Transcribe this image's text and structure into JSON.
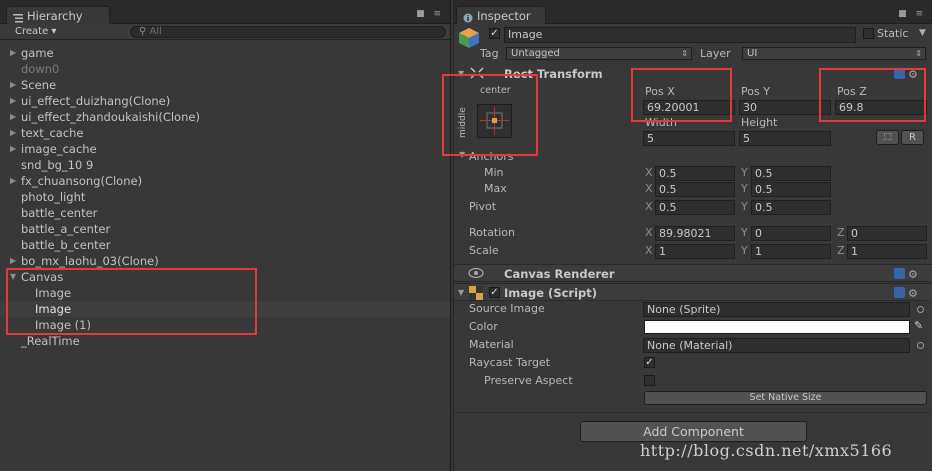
{
  "hierarchy": {
    "tab_title": "Hierarchy",
    "create_label": "Create ▾",
    "search_placeholder": "All",
    "items": [
      {
        "label": "game",
        "expandable": true
      },
      {
        "label": "down0",
        "expandable": false,
        "dim": true
      },
      {
        "label": "Scene",
        "expandable": true
      },
      {
        "label": "ui_effect_duizhang(Clone)",
        "expandable": true
      },
      {
        "label": "ui_effect_zhandoukaishi(Clone)",
        "expandable": true
      },
      {
        "label": "text_cache",
        "expandable": true
      },
      {
        "label": "image_cache",
        "expandable": true
      },
      {
        "label": "snd_bg_10 9",
        "expandable": false
      },
      {
        "label": "fx_chuansong(Clone)",
        "expandable": true
      },
      {
        "label": "photo_light",
        "expandable": false
      },
      {
        "label": "battle_center",
        "expandable": false
      },
      {
        "label": "battle_a_center",
        "expandable": false
      },
      {
        "label": "battle_b_center",
        "expandable": false
      },
      {
        "label": "bo_mx_laohu_03(Clone)",
        "expandable": true
      },
      {
        "label": "Canvas",
        "expandable": true,
        "expanded": true
      },
      {
        "label": "Image",
        "expandable": false,
        "child": true
      },
      {
        "label": "Image",
        "expandable": false,
        "child": true,
        "selected": true
      },
      {
        "label": "Image (1)",
        "expandable": false,
        "child": true
      },
      {
        "label": "_RealTime",
        "expandable": false
      }
    ]
  },
  "inspector": {
    "tab_title": "Inspector",
    "object_name": "Image",
    "static_label": "Static",
    "tag_label": "Tag",
    "tag_value": "Untagged",
    "layer_label": "Layer",
    "layer_value": "UI",
    "rect_transform": {
      "title": "Rect Transform",
      "anchor_preset_h": "center",
      "anchor_preset_v": "middle",
      "pos_x_label": "Pos X",
      "pos_x": "69.20001",
      "pos_y_label": "Pos Y",
      "pos_y": "30",
      "pos_z_label": "Pos Z",
      "pos_z": "69.8",
      "width_label": "Width",
      "width": "5",
      "height_label": "Height",
      "height": "5",
      "r_label": "R",
      "anchors_label": "Anchors",
      "min_label": "Min",
      "min_x": "0.5",
      "min_y": "0.5",
      "max_label": "Max",
      "max_x": "0.5",
      "max_y": "0.5",
      "pivot_label": "Pivot",
      "pivot_x": "0.5",
      "pivot_y": "0.5",
      "rotation_label": "Rotation",
      "rot_x": "89.98021",
      "rot_y": "0",
      "rot_z": "0",
      "scale_label": "Scale",
      "scale_x": "1",
      "scale_y": "1",
      "scale_z": "1",
      "axis_x": "X",
      "axis_y": "Y",
      "axis_z": "Z"
    },
    "canvas_renderer": {
      "title": "Canvas Renderer"
    },
    "image_script": {
      "title": "Image (Script)",
      "source_image_label": "Source Image",
      "source_image_value": "None (Sprite)",
      "color_label": "Color",
      "color_value": "#ffffff",
      "material_label": "Material",
      "material_value": "None (Material)",
      "raycast_label": "Raycast Target",
      "preserve_label": "Preserve Aspect",
      "native_size_label": "Set Native Size"
    },
    "add_component_label": "Add Component"
  },
  "watermark": "http://blog.csdn.net/xmx5166",
  "colors": {
    "highlight_box": "#e2393c",
    "selection": "#3e3e3e",
    "panel_bg": "#383838"
  }
}
